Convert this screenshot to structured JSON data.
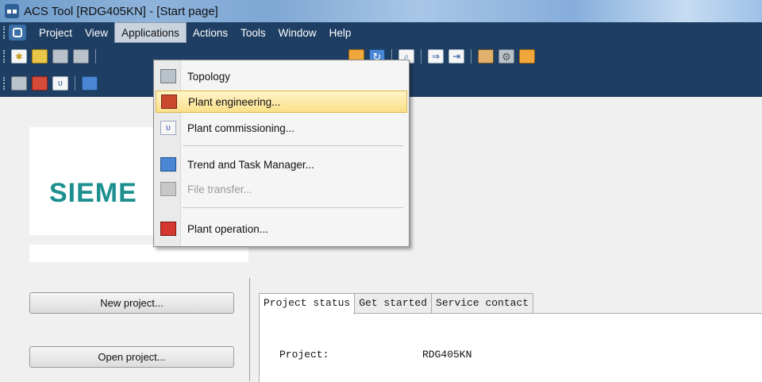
{
  "window": {
    "title": "ACS Tool [RDG405KN] - [Start page]"
  },
  "menubar": {
    "items": [
      "Project",
      "View",
      "Applications",
      "Actions",
      "Tools",
      "Window",
      "Help"
    ],
    "active": "Applications"
  },
  "applications_menu": {
    "items": [
      {
        "label": "Topology",
        "icon": "topology-icon",
        "state": "normal"
      },
      {
        "label": "Plant engineering...",
        "icon": "plant-engineering-icon",
        "state": "highlighted"
      },
      {
        "label": "Plant commissioning...",
        "icon": "plant-commissioning-icon",
        "state": "normal"
      },
      {
        "label": "Trend and Task Manager...",
        "icon": "trend-icon",
        "state": "normal"
      },
      {
        "label": "File transfer...",
        "icon": "file-transfer-icon",
        "state": "disabled"
      },
      {
        "label": "Plant operation...",
        "icon": "plant-operation-icon",
        "state": "normal"
      }
    ]
  },
  "start_page": {
    "logo_text": "SIEME",
    "buttons": {
      "new_project": "New project...",
      "open_project": "Open project..."
    },
    "tabs": [
      "Project status",
      "Get started",
      "Service contact"
    ],
    "active_tab": "Project status",
    "fields": {
      "project_label": "Project:",
      "project_value": "RDG405KN"
    }
  },
  "colors": {
    "titlebar": "#8fb4dc",
    "menubar": "#1e3f63",
    "highlight": "#fbe08a",
    "siemens": "#1d8f8f"
  }
}
